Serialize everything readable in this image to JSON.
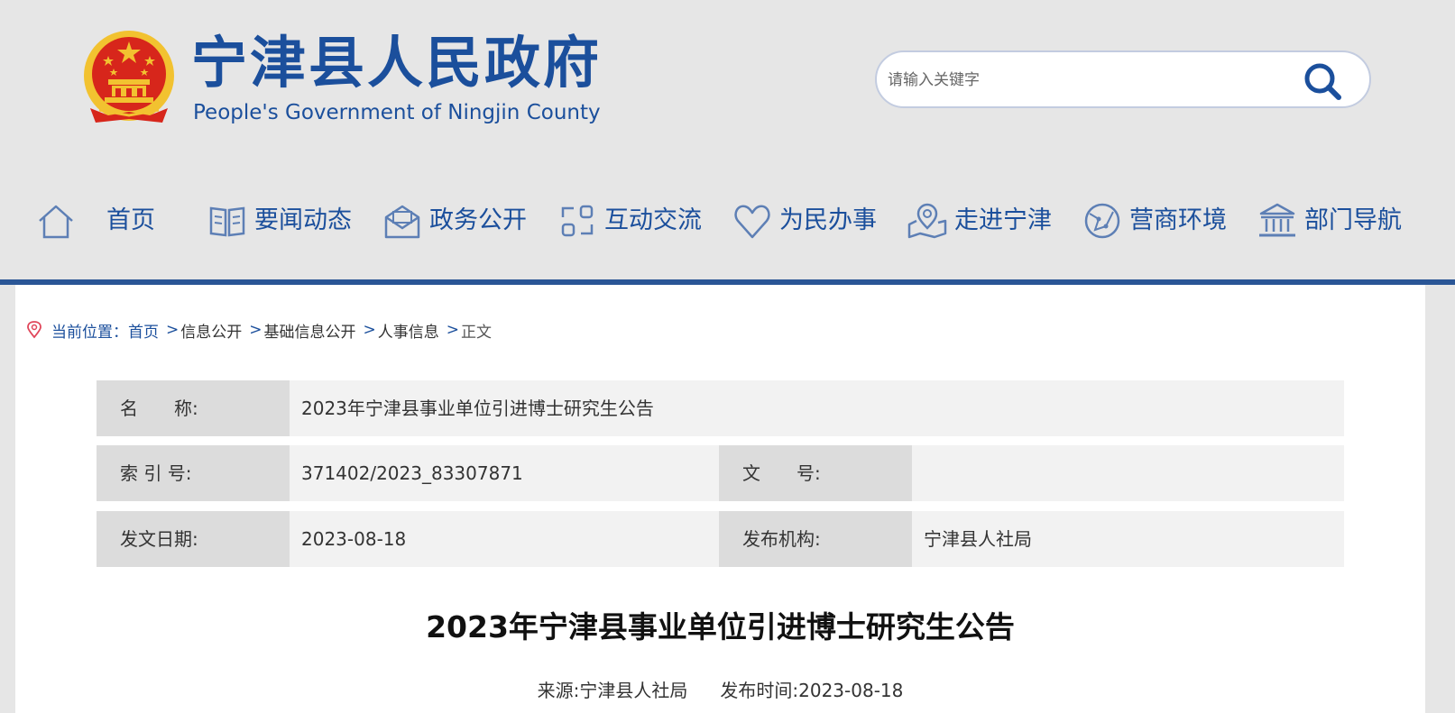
{
  "header": {
    "title": "宁津县人民政府",
    "subtitle": "People's Government of Ningjin County"
  },
  "search": {
    "placeholder": "请输入关键字"
  },
  "nav": {
    "items": [
      {
        "label": "首页",
        "icon": "home-icon"
      },
      {
        "label": "要闻动态",
        "icon": "book-icon"
      },
      {
        "label": "政务公开",
        "icon": "mail-icon"
      },
      {
        "label": "互动交流",
        "icon": "interact-icon"
      },
      {
        "label": "为民办事",
        "icon": "heart-icon"
      },
      {
        "label": "走进宁津",
        "icon": "map-pin-icon"
      },
      {
        "label": "营商环境",
        "icon": "globe-icon"
      },
      {
        "label": "部门导航",
        "icon": "building-icon"
      }
    ]
  },
  "breadcrumb": {
    "label": "当前位置：",
    "items": [
      "首页",
      "信息公开",
      "基础信息公开",
      "人事信息",
      "正文"
    ],
    "sep": ">"
  },
  "meta": {
    "name_key": "名　　称:",
    "name_value": "2023年宁津县事业单位引进博士研究生公告",
    "index_key": "索 引 号:",
    "index_value": "371402/2023_83307871",
    "doc_key": "文　　号:",
    "doc_value": "",
    "date_key": "发文日期:",
    "date_value": "2023-08-18",
    "org_key": "发布机构:",
    "org_value": "宁津县人社局"
  },
  "article": {
    "title": "2023年宁津县事业单位引进博士研究生公告",
    "source": "来源:宁津县人社局",
    "time": "发布时间:2023-08-18"
  },
  "colors": {
    "brand": "#1b4f9c",
    "nav_bar": "#2a5696",
    "emblem_red": "#d7261b",
    "emblem_gold": "#f2c230"
  }
}
